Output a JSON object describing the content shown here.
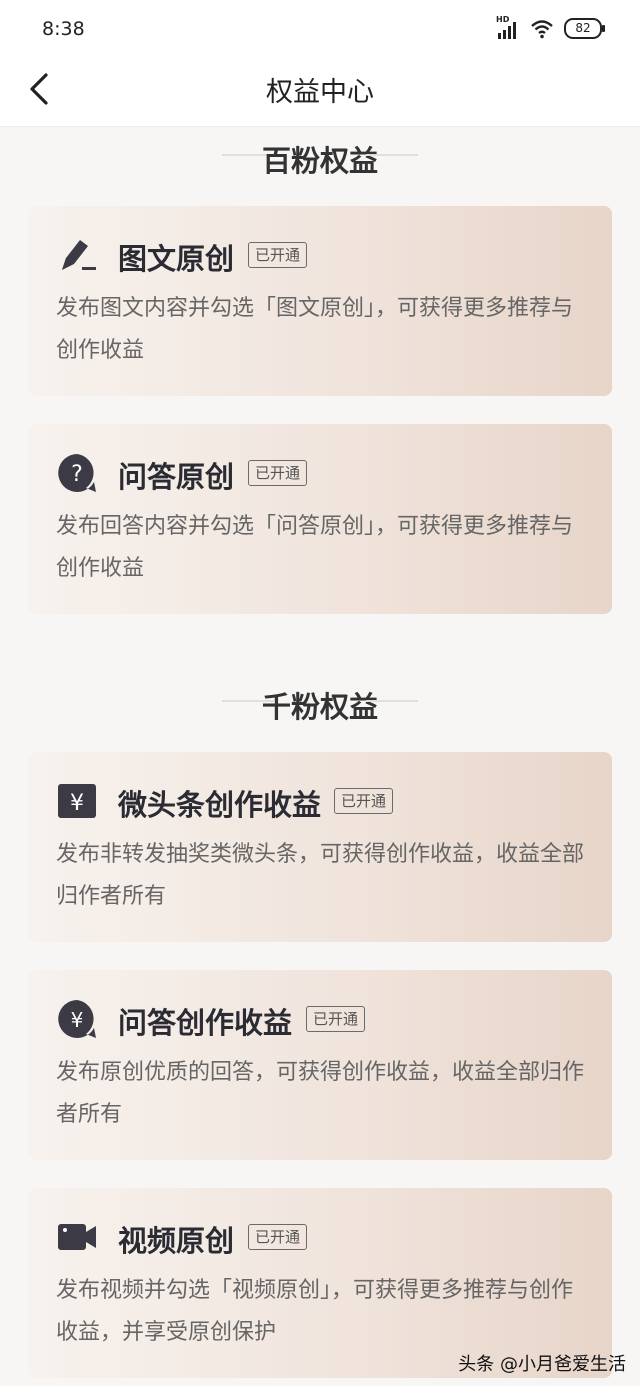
{
  "status_bar": {
    "time": "8:38",
    "signal_label": "HD",
    "battery": "82"
  },
  "header": {
    "title": "权益中心"
  },
  "sections": [
    {
      "title": "百粉权益",
      "cards": [
        {
          "icon": "edit-pencil-icon",
          "title": "图文原创",
          "badge": "已开通",
          "desc": "发布图文内容并勾选「图文原创」，可获得更多推荐与创作收益"
        },
        {
          "icon": "question-bubble-icon",
          "title": "问答原创",
          "badge": "已开通",
          "desc": "发布回答内容并勾选「问答原创」，可获得更多推荐与创作收益"
        }
      ]
    },
    {
      "title": "千粉权益",
      "cards": [
        {
          "icon": "yen-square-icon",
          "title": "微头条创作收益",
          "badge": "已开通",
          "desc": "发布非转发抽奖类微头条，可获得创作收益，收益全部归作者所有"
        },
        {
          "icon": "yen-bubble-icon",
          "title": "问答创作收益",
          "badge": "已开通",
          "desc": "发布原创优质的回答，可获得创作收益，收益全部归作者所有"
        },
        {
          "icon": "video-camera-icon",
          "title": "视频原创",
          "badge": "已开通",
          "desc": "发布视频并勾选「视频原创」，可获得更多推荐与创作收益，并享受原创保护"
        }
      ]
    }
  ],
  "watermark": "头条 @小月爸爱生活",
  "colors": {
    "icon_dark": "#3b3a45",
    "card_gradient_start": "#f7f2ee",
    "card_gradient_end": "#e7d5c9"
  }
}
